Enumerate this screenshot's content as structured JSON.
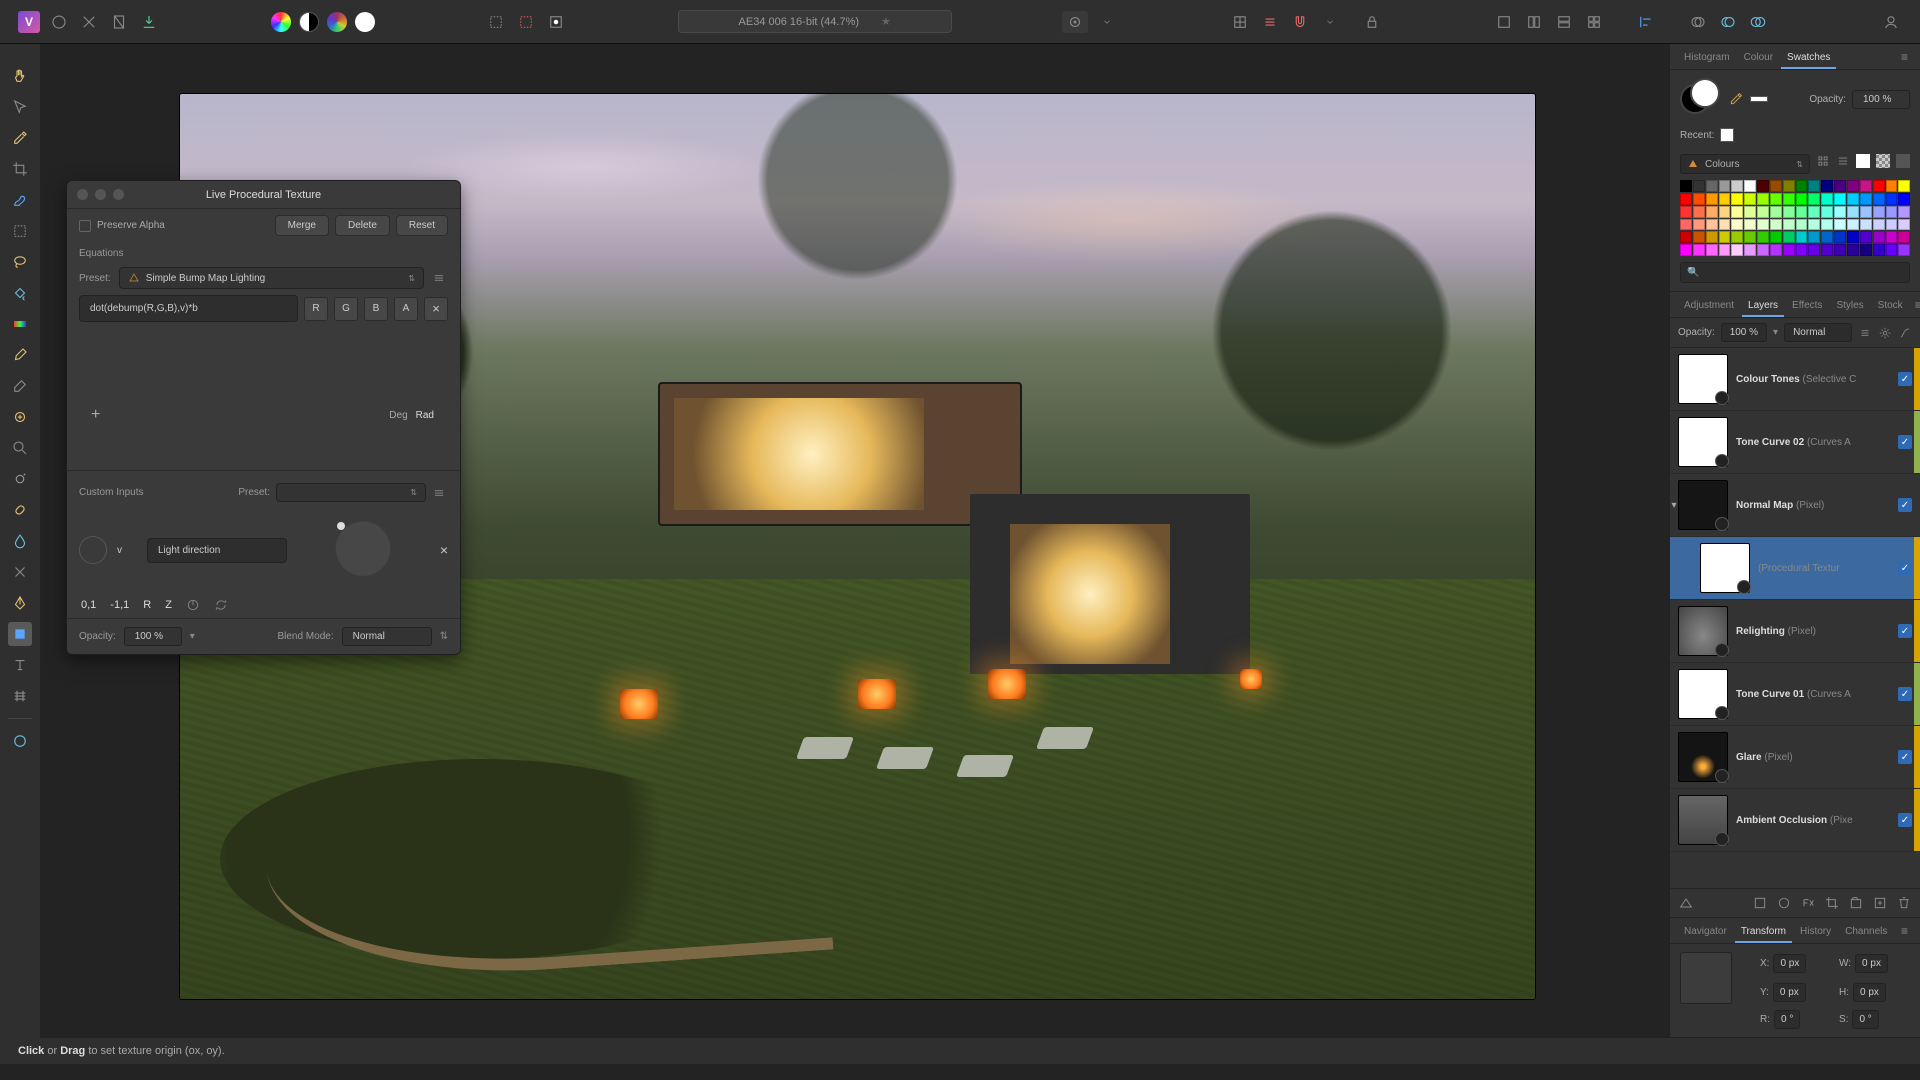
{
  "doc": {
    "title": "AE34 006 16-bit (44.7%)"
  },
  "status": {
    "prefix": "Click",
    "middle": " or ",
    "bold2": "Drag",
    "rest": " to set texture origin (ox, oy)."
  },
  "dialog": {
    "title": "Live Procedural Texture",
    "preserve_alpha": "Preserve Alpha",
    "merge": "Merge",
    "delete": "Delete",
    "reset": "Reset",
    "equations_label": "Equations",
    "preset_label": "Preset:",
    "preset_value": "Simple Bump Map Lighting",
    "equation": "dot(debump(R,G,B),v)*b",
    "chips": [
      "R",
      "G",
      "B",
      "A"
    ],
    "deg": "Deg",
    "rad": "Rad",
    "custom_inputs_label": "Custom Inputs",
    "ci_preset_label": "Preset:",
    "ci_var": "v",
    "ci_name": "Light direction",
    "nums": {
      "a": "0,1",
      "b": "-1,1",
      "r": "R",
      "z": "Z"
    },
    "opacity_label": "Opacity:",
    "opacity_value": "100 %",
    "blend_label": "Blend Mode:",
    "blend_value": "Normal"
  },
  "colour_panel": {
    "tabs": [
      "Histogram",
      "Colour",
      "Swatches"
    ],
    "opacity_label": "Opacity:",
    "opacity_value": "100 %",
    "recent_label": "Recent:",
    "swatch_select": "Colours",
    "search_placeholder": "🔍"
  },
  "swatch_colours": [
    "#000000",
    "#333333",
    "#666666",
    "#999999",
    "#cccccc",
    "#ffffff",
    "#4b0000",
    "#964b00",
    "#808000",
    "#008000",
    "#008080",
    "#000080",
    "#4b0082",
    "#800080",
    "#c71585",
    "#ff0000",
    "#ff8000",
    "#ffff00",
    "#ff0000",
    "#ff4d00",
    "#ff9900",
    "#ffcc00",
    "#ffff00",
    "#ccff00",
    "#99ff00",
    "#66ff00",
    "#33ff00",
    "#00ff00",
    "#00ff66",
    "#00ffcc",
    "#00ffff",
    "#00ccff",
    "#0099ff",
    "#0066ff",
    "#0033ff",
    "#0000ff",
    "#ff3333",
    "#ff704d",
    "#ffad66",
    "#ffd480",
    "#ffff99",
    "#e0ff99",
    "#c2ff99",
    "#a3ff99",
    "#85ff99",
    "#66ff99",
    "#66ffc2",
    "#66ffe0",
    "#99ffff",
    "#99e0ff",
    "#99c2ff",
    "#99a3ff",
    "#9999ff",
    "#b399ff",
    "#ff6666",
    "#ff9980",
    "#ffc299",
    "#ffe0b3",
    "#ffffcc",
    "#f0ffcc",
    "#e0ffcc",
    "#d1ffcc",
    "#c2ffcc",
    "#b3ffcc",
    "#b3ffe0",
    "#b3fff0",
    "#ccffff",
    "#ccf0ff",
    "#cce0ff",
    "#ccd1ff",
    "#ccccff",
    "#dbccff",
    "#cc0000",
    "#cc5200",
    "#cc9900",
    "#cccc00",
    "#99cc00",
    "#66cc00",
    "#33cc00",
    "#00cc00",
    "#00cc66",
    "#00cccc",
    "#0099cc",
    "#0066cc",
    "#0033cc",
    "#0000cc",
    "#5200cc",
    "#9900cc",
    "#cc00cc",
    "#cc0099",
    "#ff00ff",
    "#ff33ff",
    "#ff66ff",
    "#ff99ff",
    "#ffccff",
    "#e699ff",
    "#cc66ff",
    "#b333ff",
    "#9900ff",
    "#8000ff",
    "#6600e6",
    "#5200cc",
    "#3d00b3",
    "#290099",
    "#140080",
    "#3300cc",
    "#6600ff",
    "#9933ff"
  ],
  "layers_panel": {
    "tabs": [
      "Adjustment",
      "Layers",
      "Effects",
      "Styles",
      "Stock"
    ],
    "opacity_label": "Opacity:",
    "opacity_value": "100 %",
    "blend_value": "Normal",
    "layers": [
      {
        "name": "Colour Tones",
        "type": "(Selective C",
        "tag": "#d6a400",
        "thumb": "white"
      },
      {
        "name": "Tone Curve 02",
        "type": "(Curves A",
        "tag": "#8fb34a",
        "thumb": "white"
      },
      {
        "name": "Normal Map",
        "type": "(Pixel)",
        "tag": "",
        "thumb": "dark",
        "expand": true
      },
      {
        "name": "",
        "type": "(Procedural Textur",
        "tag": "#d6a400",
        "thumb": "white",
        "child": true,
        "selected": true
      },
      {
        "name": "Relighting",
        "type": "(Pixel)",
        "tag": "#d6a400",
        "thumb": "relight"
      },
      {
        "name": "Tone Curve 01",
        "type": "(Curves A",
        "tag": "#8fb34a",
        "thumb": "white"
      },
      {
        "name": "Glare",
        "type": "(Pixel)",
        "tag": "#d6a400",
        "thumb": "glare"
      },
      {
        "name": "Ambient Occlusion",
        "type": "(Pixe",
        "tag": "#d6a400",
        "thumb": "ao"
      }
    ]
  },
  "transform_panel": {
    "tabs": [
      "Navigator",
      "Transform",
      "History",
      "Channels"
    ],
    "x_label": "X:",
    "x": "0 px",
    "y_label": "Y:",
    "y": "0 px",
    "w_label": "W:",
    "w": "0 px",
    "h_label": "H:",
    "h": "0 px",
    "r_label": "R:",
    "r": "0 °",
    "s_label": "S:",
    "s": "0 °"
  }
}
